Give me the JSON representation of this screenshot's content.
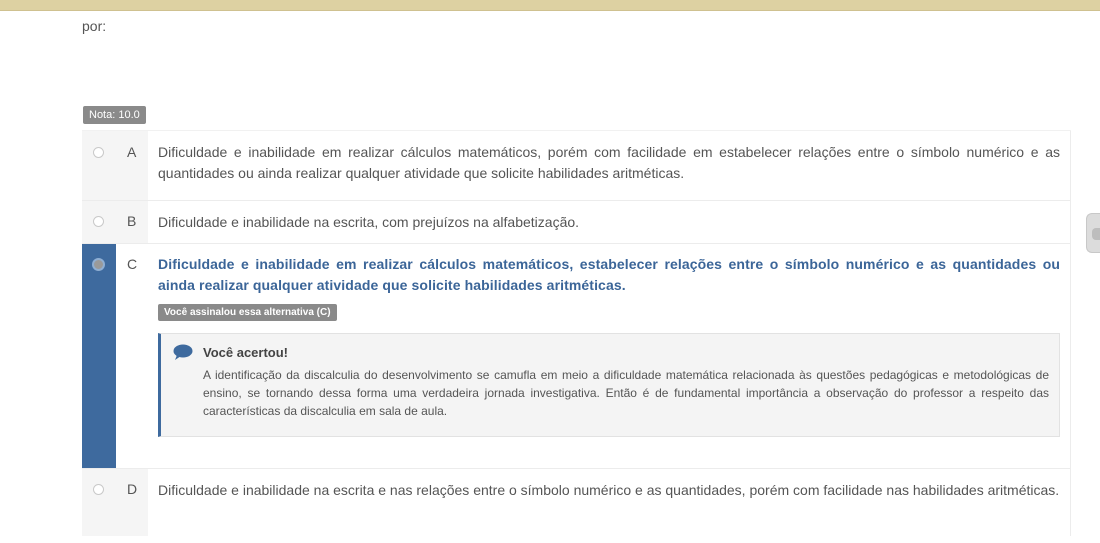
{
  "question": {
    "tail_text": "por:"
  },
  "grade_badge": "Nota: 10.0",
  "alternatives": [
    {
      "letter": "A",
      "text": "Dificuldade e inabilidade em realizar cálculos matemáticos, porém com facilidade em estabelecer relações entre o símbolo numérico e as quantidades ou ainda realizar qualquer atividade que solicite habilidades aritméticas."
    },
    {
      "letter": "B",
      "text": "Dificuldade e inabilidade na escrita, com prejuízos na alfabetização."
    },
    {
      "letter": "C",
      "text": "Dificuldade e inabilidade em realizar cálculos matemáticos, estabelecer relações entre o símbolo numérico e as quantidades ou ainda realizar qualquer atividade que solicite habilidades aritméticas.",
      "marked_label": "Você assinalou essa alternativa (C)",
      "feedback": {
        "icon": "chat-bubble-icon",
        "title": "Você acertou!",
        "text": "A identificação da discalculia do desenvolvimento se camufla em meio a dificuldade matemática relacionada às questões pedagógicas e metodológicas de ensino, se tornando dessa forma uma verdadeira jornada investigativa. Então é de fundamental importância a observação do professor a respeito das características da discalculia em sala de aula."
      }
    },
    {
      "letter": "D",
      "text": "Dificuldade e inabilidade na escrita e nas relações entre o símbolo numérico e as quantidades, porém com facilidade nas habilidades aritméticas."
    }
  ],
  "colors": {
    "top_bar": "#ddd1a2",
    "selected_accent": "#3e6a9e",
    "selected_text": "#3b6598",
    "badge_bg": "#8a8a8a"
  }
}
